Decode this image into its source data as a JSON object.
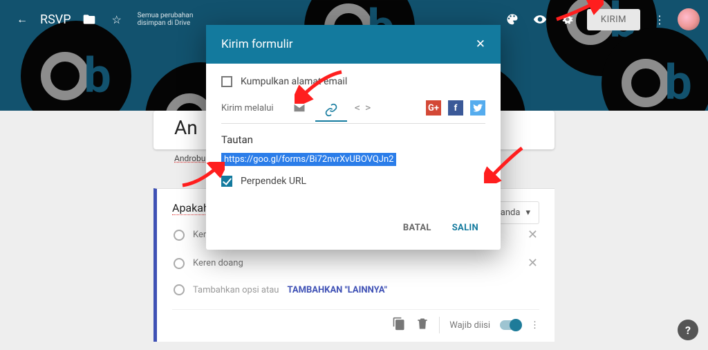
{
  "header": {
    "title": "RSVP",
    "save_state": "Semua perubahan disimpan di Drive",
    "send_button": "KIRIM"
  },
  "form": {
    "title_partial": "An",
    "description": "Androbu",
    "question_title": "Apakah Androbuntu Keren?",
    "type_selector": "Pilihan ganda",
    "options": [
      "Keren banget",
      "Keren doang"
    ],
    "add_option_prefix": "Tambahkan opsi  atau ",
    "add_option_link": "TAMBAHKAN \"LAINNYA\"",
    "required_label": "Wajib diisi"
  },
  "modal": {
    "title": "Kirim formulir",
    "collect_label": "Kumpulkan alamat email",
    "send_via_label": "Kirim melalui",
    "section_label": "Tautan",
    "url": "https://goo.gl/forms/Bi72nvrXvUBOVQJn2",
    "shorten_label": "Perpendek URL",
    "cancel": "BATAL",
    "copy": "SALIN"
  }
}
